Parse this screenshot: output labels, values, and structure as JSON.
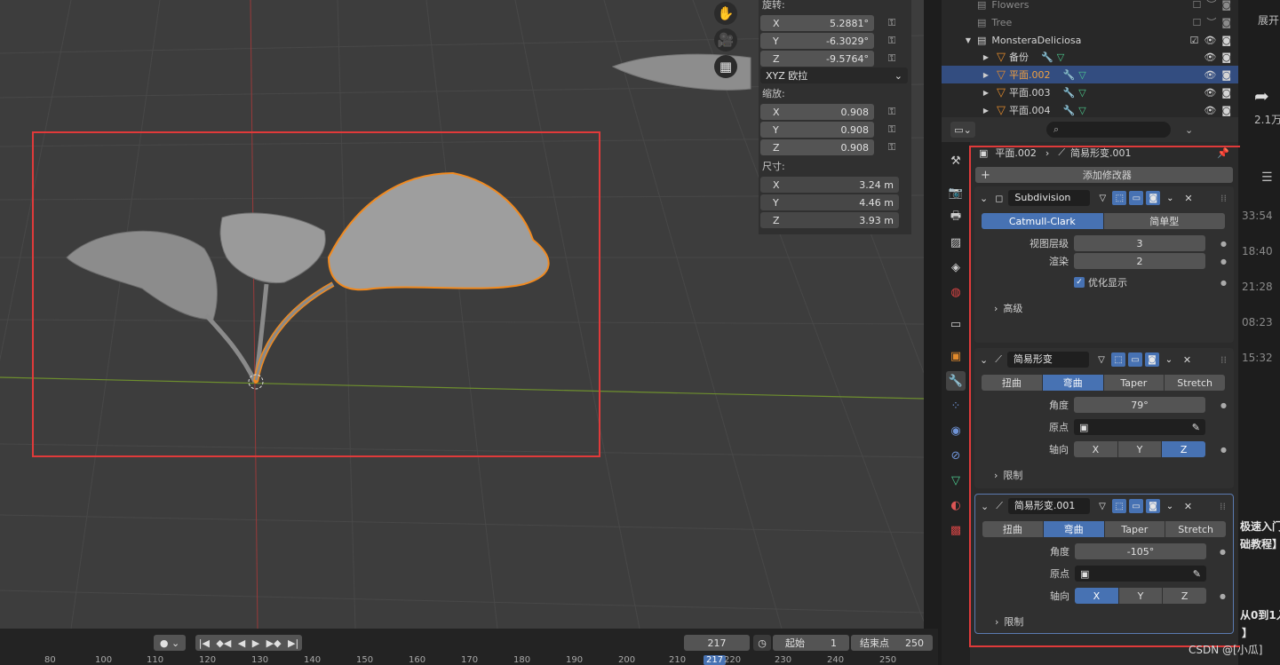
{
  "viewport": {
    "nav_icons": [
      "hand-icon",
      "camera-icon",
      "grid-icon"
    ]
  },
  "npanel": {
    "rotation": {
      "label": "旋转:",
      "x": "5.2881°",
      "y": "-6.3029°",
      "z": "-9.5764°",
      "mode": "XYZ 欧拉"
    },
    "scale": {
      "label": "缩放:",
      "x": "0.908",
      "y": "0.908",
      "z": "0.908"
    },
    "dimensions": {
      "label": "尺寸:",
      "x": "3.24 m",
      "y": "4.46 m",
      "z": "3.93 m"
    },
    "axis_x": "X",
    "axis_y": "Y",
    "axis_z": "Z"
  },
  "timeline": {
    "current_frame": "217",
    "start_label": "起始",
    "start": "1",
    "end_label": "结束点",
    "end": "250",
    "ruler": [
      "80",
      "100",
      "110",
      "120",
      "130",
      "140",
      "150",
      "160",
      "170",
      "180",
      "190",
      "200",
      "210",
      "217",
      "220",
      "230",
      "240",
      "250"
    ]
  },
  "outliner": {
    "items": [
      {
        "name": "Flowers",
        "level": 1
      },
      {
        "name": "Tree",
        "level": 1
      },
      {
        "name": "MonsteraDeliciosa",
        "level": 0
      },
      {
        "name": "备份",
        "level": 2
      },
      {
        "name": "平面.002",
        "level": 2
      },
      {
        "name": "平面.003",
        "level": 2
      },
      {
        "name": "平面.004",
        "level": 2
      }
    ]
  },
  "props": {
    "breadcrumb_object": "平面.002",
    "breadcrumb_modifier": "简易形变.001",
    "add_modifier": "添加修改器",
    "subdivision": {
      "name": "Subdivision",
      "mode_a": "Catmull-Clark",
      "mode_b": "简单型",
      "viewport_label": "视图层级",
      "viewport": "3",
      "render_label": "渲染",
      "render": "2",
      "optimize_label": "优化显示",
      "advanced": "高级"
    },
    "deform1": {
      "name": "简易形变",
      "modes": [
        "扭曲",
        "弯曲",
        "Taper",
        "Stretch"
      ],
      "angle_label": "角度",
      "angle": "79°",
      "origin_label": "原点",
      "axis_label": "轴向",
      "axes": [
        "X",
        "Y",
        "Z"
      ],
      "active_axis": "Z",
      "limits": "限制"
    },
    "deform2": {
      "name": "简易形变.001",
      "modes": [
        "扭曲",
        "弯曲",
        "Taper",
        "Stretch"
      ],
      "angle_label": "角度",
      "angle": "-105°",
      "origin_label": "原点",
      "axis_label": "轴向",
      "axes": [
        "X",
        "Y",
        "Z"
      ],
      "active_axis": "X",
      "limits": "限制"
    }
  },
  "rightpanel": {
    "expand": "展开",
    "share_count": "2.1万",
    "times": [
      "33:54",
      "18:40",
      "21:28",
      "08:23",
      "15:32"
    ],
    "snippet1": "极速入门",
    "snippet2": "础教程】",
    "snippet3": "从0到1入",
    "snippet4": "】",
    "watermark": "CSDN @[小瓜]"
  }
}
